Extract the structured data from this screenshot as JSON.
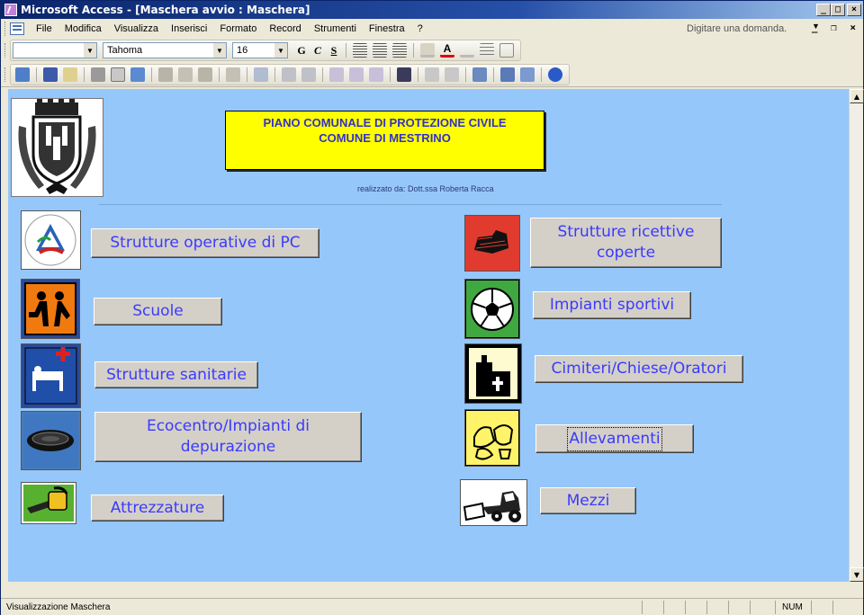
{
  "window": {
    "title": "Microsoft Access - [Maschera avvio : Maschera]"
  },
  "menubar": {
    "items": [
      "File",
      "Modifica",
      "Visualizza",
      "Inserisci",
      "Formato",
      "Record",
      "Strumenti",
      "Finestra",
      "?"
    ],
    "help_placeholder": "Digitare una domanda."
  },
  "format_toolbar": {
    "font_name": "Tahoma",
    "font_size": "16",
    "bold": "G",
    "italic": "C",
    "underline": "S"
  },
  "form": {
    "title_line1": "PIANO COMUNALE DI PROTEZIONE CIVILE",
    "title_line2": "COMUNE DI MESTRINO",
    "credit": "realizzato da: Dott.ssa Roberta Racca",
    "background_color": "#96c7fa",
    "left_buttons": [
      {
        "label": "Strutture operative di PC",
        "icon": "protezione-civile-logo-icon"
      },
      {
        "label": "Scuole",
        "icon": "school-children-icon"
      },
      {
        "label": "Strutture sanitarie",
        "icon": "hospital-bed-icon"
      },
      {
        "label": "Ecocentro/Impianti di depurazione",
        "icon": "water-treatment-icon"
      },
      {
        "label": "Attrezzature",
        "icon": "chainsaw-icon"
      }
    ],
    "right_buttons": [
      {
        "label": "Strutture ricettive coperte",
        "icon": "brick-building-icon"
      },
      {
        "label": "Impianti sportivi",
        "icon": "soccer-ball-icon"
      },
      {
        "label": "Cimiteri/Chiese/Oratori",
        "icon": "church-icon"
      },
      {
        "label": "Allevamenti",
        "icon": "livestock-icon"
      },
      {
        "label": "Mezzi",
        "icon": "bulldozer-icon"
      }
    ]
  },
  "statusbar": {
    "text": "Visualizzazione Maschera",
    "num": "NUM"
  }
}
